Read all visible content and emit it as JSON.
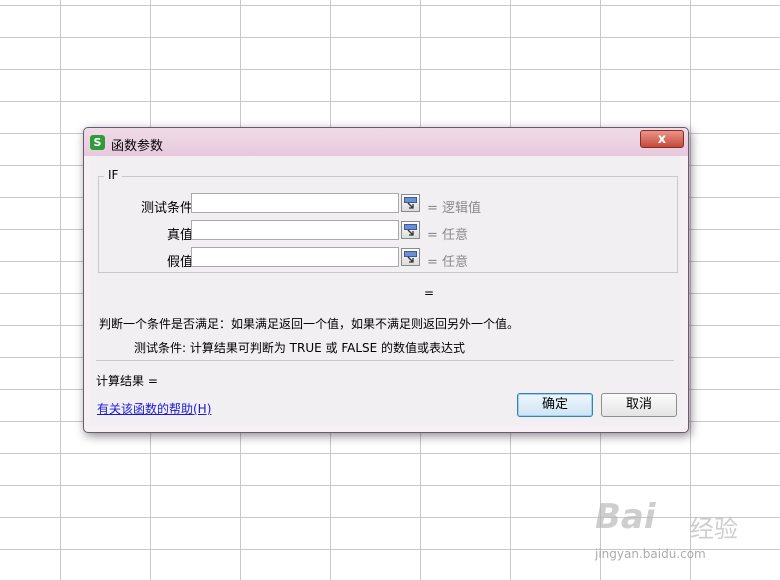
{
  "dialog": {
    "title": "函数参数",
    "app_icon_glyph": "S",
    "close_glyph": "x",
    "function_name": "IF",
    "args": [
      {
        "label": "测试条件",
        "value": "",
        "hint": "= 逻辑值"
      },
      {
        "label": "真值",
        "value": "",
        "hint": "= 任意"
      },
      {
        "label": "假值",
        "value": "",
        "hint": "= 任意"
      }
    ],
    "result_eq": "=",
    "description": "判断一个条件是否满足：如果满足返回一个值，如果不满足则返回另外一个值。",
    "arg_description": "测试条件:  计算结果可判断为 TRUE 或 FALSE 的数值或表达式",
    "calc_result": "计算结果 =",
    "help_link": "有关该函数的帮助(H)",
    "ok_label": "确定",
    "cancel_label": "取消"
  },
  "watermark": {
    "brand": "Bai",
    "brand_cn": "经验",
    "url": "jingyan.baidu.com"
  },
  "colors": {
    "titlebar": "#e6c9dc",
    "close": "#c54a3a",
    "link": "#1b1bd6",
    "grid": "#c8c8c8"
  }
}
